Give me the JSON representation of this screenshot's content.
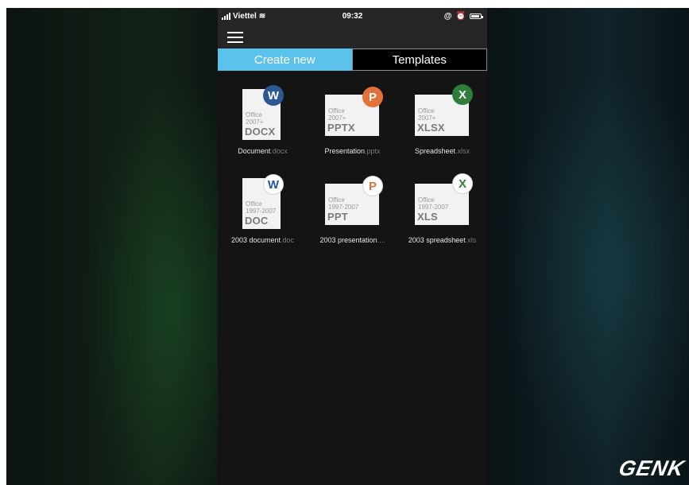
{
  "status_bar": {
    "carrier": "Viettel",
    "time": "09:32",
    "icons": [
      "signal-icon",
      "wifi-icon",
      "at-icon",
      "alarm-icon",
      "battery-icon"
    ]
  },
  "header": {
    "menu_icon": "hamburger-icon"
  },
  "tabs": [
    {
      "label": "Create new",
      "active": true
    },
    {
      "label": "Templates",
      "active": false
    }
  ],
  "files": [
    {
      "name": "Document",
      "ext": ".docx",
      "badge": "W",
      "icon_line1": "Office",
      "icon_line2": "2007+",
      "icon_ext": "DOCX",
      "color": "#2b5797",
      "style": "solid"
    },
    {
      "name": "Presentation",
      "ext": ".pptx",
      "badge": "P",
      "icon_line1": "Office",
      "icon_line2": "2007+",
      "icon_ext": "PPTX",
      "color": "#e3713a",
      "style": "solid"
    },
    {
      "name": "Spreadsheet",
      "ext": ".xlsx",
      "badge": "X",
      "icon_line1": "Office",
      "icon_line2": "2007+",
      "icon_ext": "XLSX",
      "color": "#2e7d3b",
      "style": "solid"
    },
    {
      "name": "2003 document",
      "ext": ".doc",
      "badge": "W",
      "icon_line1": "Office",
      "icon_line2": "1997-2007",
      "icon_ext": "DOC",
      "color": "#2b5797",
      "style": "outline"
    },
    {
      "name": "2003 presentation",
      "ext": "....",
      "badge": "P",
      "icon_line1": "Office",
      "icon_line2": "1997-2007",
      "icon_ext": "PPT",
      "color": "#e3713a",
      "style": "outline"
    },
    {
      "name": "2003 spreadsheet",
      "ext": ".xls",
      "badge": "X",
      "icon_line1": "Office",
      "icon_line2": "1997-2007",
      "icon_ext": "XLS",
      "color": "#2e7d3b",
      "style": "outline"
    }
  ],
  "watermark": "GENK",
  "colors": {
    "tab_active": "#5bc2ec",
    "app_background": "#141414",
    "header_background": "#262626"
  }
}
